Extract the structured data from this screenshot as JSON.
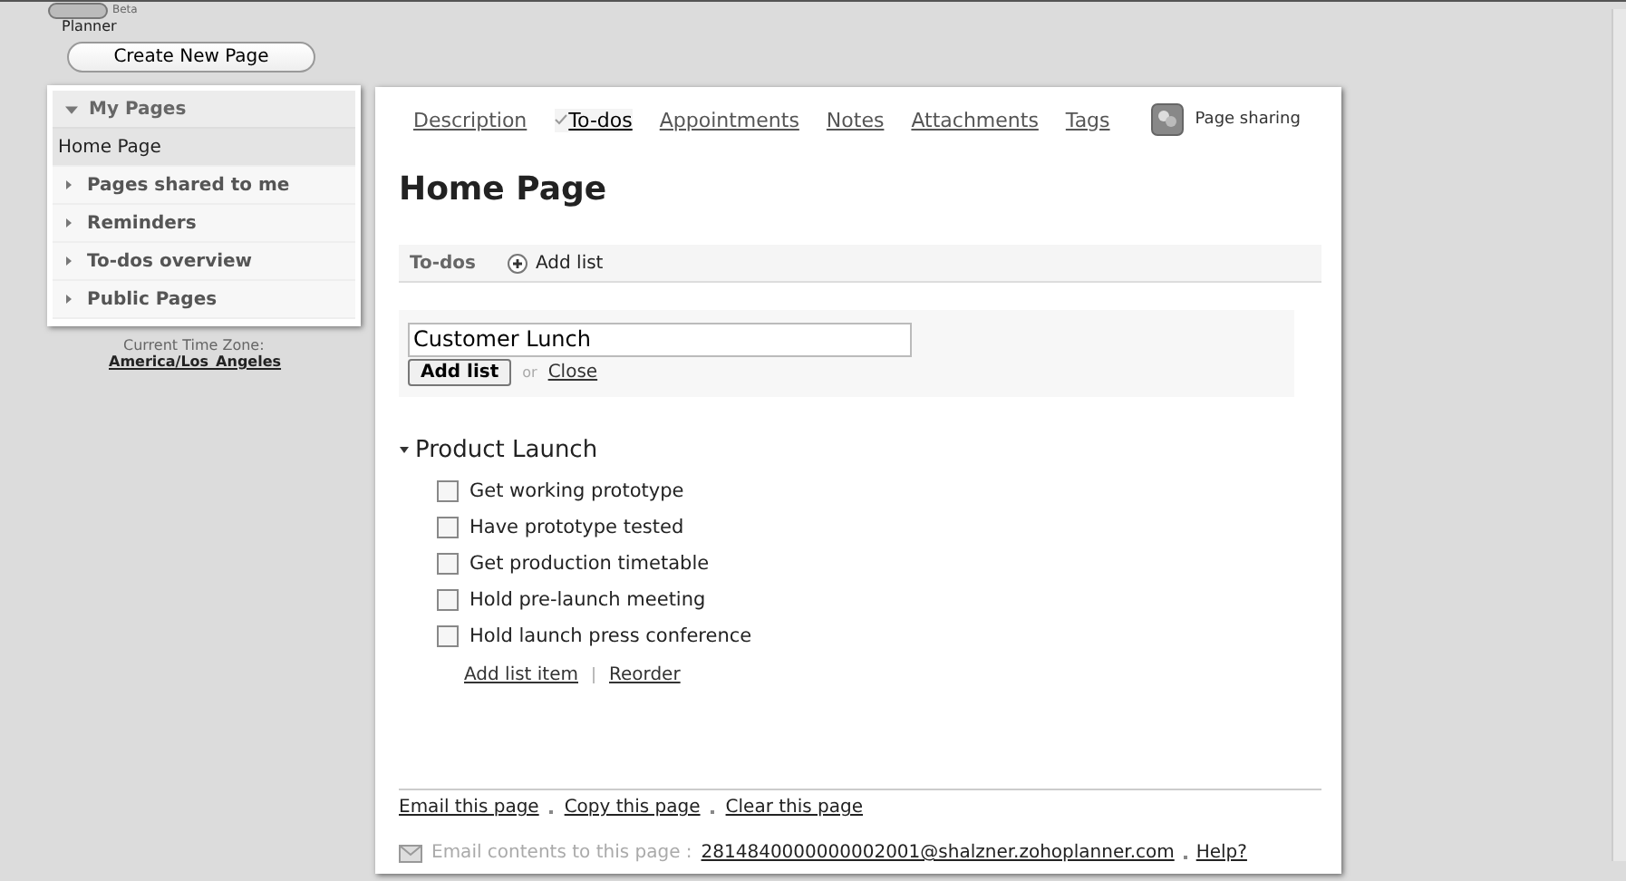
{
  "logo": {
    "badge": "Beta",
    "name": "Planner"
  },
  "create_button": "Create New Page",
  "sidebar": {
    "header": {
      "label": "My Pages",
      "expanded": true
    },
    "items": [
      {
        "label": "Home Page",
        "selected": true,
        "kind": "page"
      },
      {
        "label": "Pages shared to me",
        "selected": false,
        "kind": "section"
      },
      {
        "label": "Reminders",
        "selected": false,
        "kind": "section"
      },
      {
        "label": "To-dos overview",
        "selected": false,
        "kind": "section"
      },
      {
        "label": "Public Pages",
        "selected": false,
        "kind": "section"
      }
    ]
  },
  "timezone": {
    "label": "Current Time Zone:",
    "value": "America/Los_Angeles"
  },
  "tabs": [
    {
      "label": "Description",
      "selected": false
    },
    {
      "label": "To-dos",
      "selected": true
    },
    {
      "label": "Appointments",
      "selected": false
    },
    {
      "label": "Notes",
      "selected": false
    },
    {
      "label": "Attachments",
      "selected": false
    },
    {
      "label": "Tags",
      "selected": false
    }
  ],
  "page_sharing": "Page sharing",
  "title": "Home Page",
  "todo_bar": {
    "label": "To-dos",
    "add": "Add list"
  },
  "new_list": {
    "value": "Customer Lunch",
    "button": "Add list",
    "or": "or",
    "close": "Close"
  },
  "list": {
    "title": "Product Launch",
    "expanded": true,
    "items": [
      {
        "label": "Get working prototype",
        "checked": false
      },
      {
        "label": "Have prototype tested",
        "checked": false
      },
      {
        "label": "Get production timetable",
        "checked": false
      },
      {
        "label": "Hold pre-launch meeting",
        "checked": false
      },
      {
        "label": "Hold launch press conference",
        "checked": false
      }
    ],
    "actions": [
      "Add list item",
      "Reorder"
    ]
  },
  "footer_links": [
    "Email this page",
    "Copy this page",
    "Clear this page"
  ],
  "email": {
    "label": "Email contents to this page :",
    "address": "2814840000000002001@shalzner.zohoplanner.com",
    "help": "Help?"
  }
}
